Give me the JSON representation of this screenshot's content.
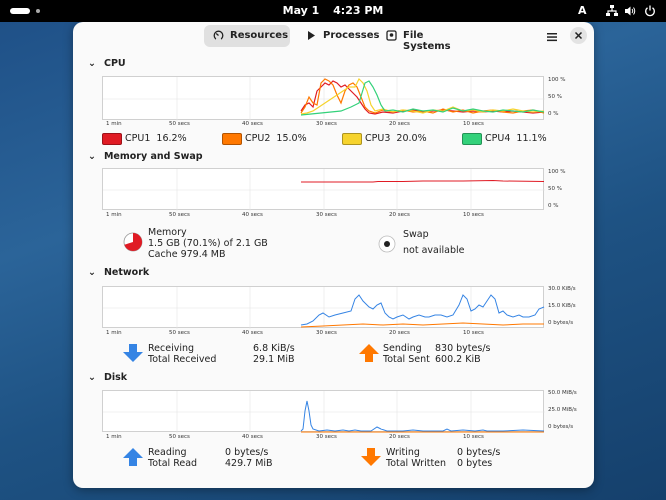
{
  "topbar": {
    "date": "May 1",
    "time": "4:23 PM",
    "input_source": "A"
  },
  "tabs": [
    {
      "label": "Resources",
      "icon": "gauge-icon",
      "active": true
    },
    {
      "label": "Processes",
      "icon": "play-icon",
      "active": false
    },
    {
      "label": "File Systems",
      "icon": "disk-icon",
      "active": false
    }
  ],
  "x_ticks": [
    "1 min",
    "50 secs",
    "40 secs",
    "30 secs",
    "20 secs",
    "10 secs"
  ],
  "cpu": {
    "title": "CPU",
    "y_ticks": [
      "100 %",
      "50 %",
      "0 %"
    ],
    "cores": [
      {
        "label": "CPU1",
        "value": "16.2%",
        "color": "#e01b24"
      },
      {
        "label": "CPU2",
        "value": "15.0%",
        "color": "#ff7800"
      },
      {
        "label": "CPU3",
        "value": "20.0%",
        "color": "#f6d32d"
      },
      {
        "label": "CPU4",
        "value": "11.1%",
        "color": "#33d17a"
      }
    ]
  },
  "memory": {
    "title": "Memory and Swap",
    "y_ticks": [
      "100 %",
      "50 %",
      "0 %"
    ],
    "mem_label": "Memory",
    "mem_used": "1.5 GB (70.1%) of 2.1 GB",
    "mem_cache": "Cache 979.4 MB",
    "mem_fraction": 0.701,
    "swap_label": "Swap",
    "swap_status": "not available"
  },
  "network": {
    "title": "Network",
    "y_ticks": [
      "30.0 KiB/s",
      "15.0 KiB/s",
      "0 bytes/s"
    ],
    "receiving_label": "Receiving",
    "receiving_value": "6.8 KiB/s",
    "total_received_label": "Total Received",
    "total_received_value": "29.1 MiB",
    "sending_label": "Sending",
    "sending_value": "830 bytes/s",
    "total_sent_label": "Total Sent",
    "total_sent_value": "600.2 KiB"
  },
  "disk": {
    "title": "Disk",
    "y_ticks": [
      "50.0 MiB/s",
      "25.0 MiB/s",
      "0 bytes/s"
    ],
    "reading_label": "Reading",
    "reading_value": "0 bytes/s",
    "total_read_label": "Total Read",
    "total_read_value": "429.7 MiB",
    "writing_label": "Writing",
    "writing_value": "0 bytes/s",
    "total_written_label": "Total Written",
    "total_written_value": "0 bytes"
  },
  "colors": {
    "receive": "#3584e4",
    "send": "#ff7800",
    "memory": "#e01b24"
  }
}
